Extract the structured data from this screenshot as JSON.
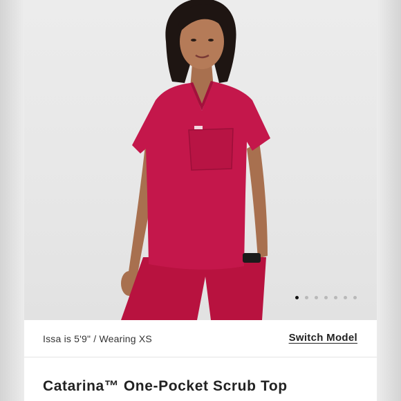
{
  "gallery": {
    "image_alt": "Woman wearing a raspberry one-pocket scrub top and matching pants",
    "dot_count": 7,
    "active_dot": 0,
    "colors": {
      "scrub": "#c4174b",
      "background": "#e9e9e9",
      "dot_active": "#111111",
      "dot_inactive": "#b9b9b9"
    }
  },
  "model": {
    "info": "Issa is 5'9\" / Wearing XS",
    "switch_label": "Switch Model"
  },
  "product": {
    "title": "Catarina™ One-Pocket Scrub Top"
  }
}
